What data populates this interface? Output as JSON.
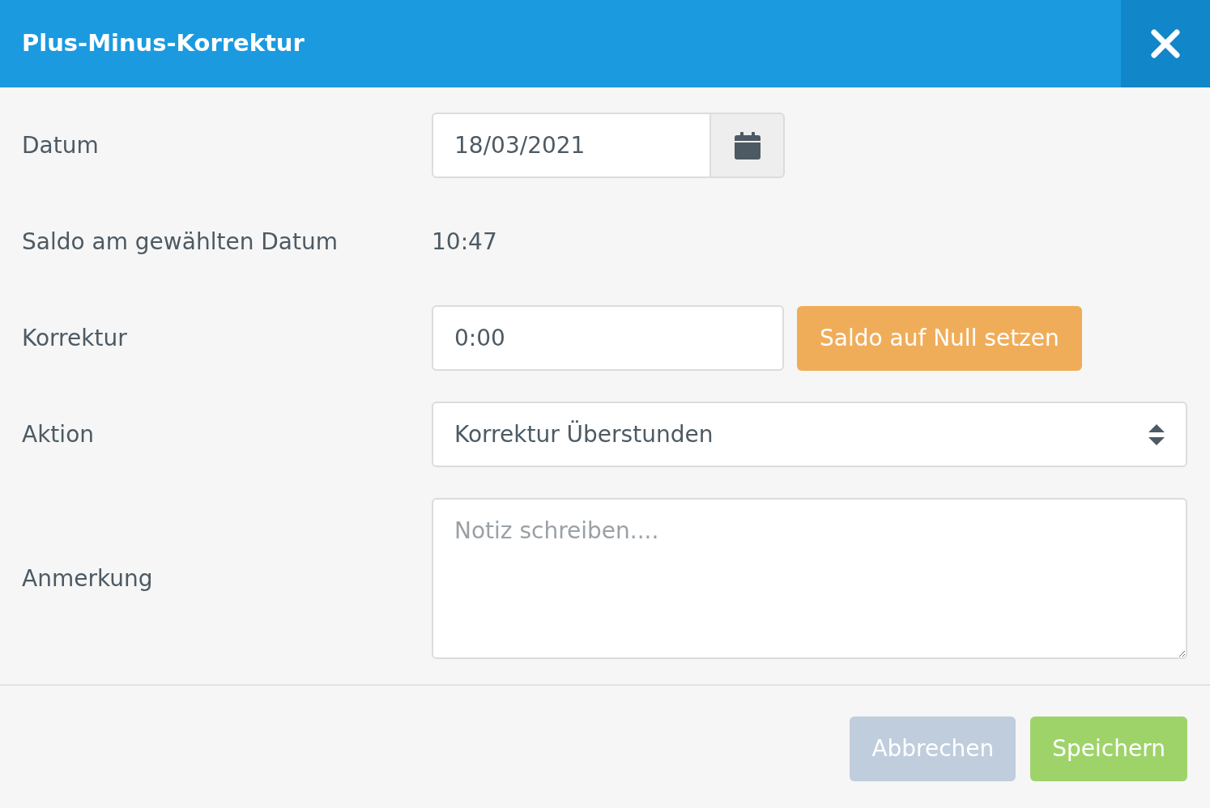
{
  "dialog": {
    "title": "Plus-Minus-Korrektur",
    "fields": [
      {
        "kind": "date",
        "label": "Datum",
        "value": "18/03/2021"
      },
      {
        "kind": "readout",
        "label": "Saldo am gewählten Datum",
        "value": "10:47"
      },
      {
        "kind": "input",
        "label": "Korrektur",
        "value": "0:00",
        "action": "Saldo auf Null setzen"
      },
      {
        "kind": "select",
        "label": "Aktion",
        "value": "Korrektur Überstunden"
      },
      {
        "kind": "textarea",
        "label": "Anmerkung",
        "placeholder": "Notiz schreiben...."
      }
    ],
    "buttons": [
      {
        "kind": "cancel",
        "label": "Abbrechen"
      },
      {
        "kind": "save",
        "label": "Speichern"
      }
    ]
  }
}
